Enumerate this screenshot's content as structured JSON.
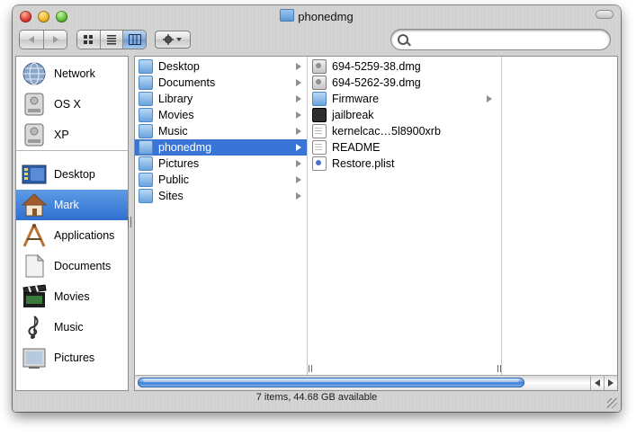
{
  "window": {
    "title": "phonedmg",
    "status": "7 items, 44.68 GB available"
  },
  "toolbar": {
    "back_icon": "back-arrow-icon",
    "forward_icon": "forward-arrow-icon",
    "view_modes": [
      "icon",
      "list",
      "column"
    ],
    "active_view": "column",
    "action_icon": "gear-icon",
    "search_placeholder": ""
  },
  "sidebar": {
    "devices": [
      {
        "label": "Network",
        "icon": "network-globe-icon"
      },
      {
        "label": "OS X",
        "icon": "hard-drive-icon"
      },
      {
        "label": "XP",
        "icon": "hard-drive-icon"
      }
    ],
    "places": [
      {
        "label": "Desktop",
        "icon": "desktop-icon",
        "selected": false
      },
      {
        "label": "Mark",
        "icon": "home-icon",
        "selected": true
      },
      {
        "label": "Applications",
        "icon": "applications-icon",
        "selected": false
      },
      {
        "label": "Documents",
        "icon": "documents-icon",
        "selected": false
      },
      {
        "label": "Movies",
        "icon": "movies-icon",
        "selected": false
      },
      {
        "label": "Music",
        "icon": "music-icon",
        "selected": false
      },
      {
        "label": "Pictures",
        "icon": "pictures-icon",
        "selected": false
      }
    ],
    "selection_color": "#3875d7"
  },
  "columns": [
    {
      "items": [
        {
          "label": "Desktop",
          "kind": "folder",
          "has_children": true,
          "selected": false
        },
        {
          "label": "Documents",
          "kind": "folder",
          "has_children": true,
          "selected": false
        },
        {
          "label": "Library",
          "kind": "folder",
          "has_children": true,
          "selected": false
        },
        {
          "label": "Movies",
          "kind": "folder",
          "has_children": true,
          "selected": false
        },
        {
          "label": "Music",
          "kind": "folder",
          "has_children": true,
          "selected": false
        },
        {
          "label": "phonedmg",
          "kind": "folder",
          "has_children": true,
          "selected": true
        },
        {
          "label": "Pictures",
          "kind": "folder",
          "has_children": true,
          "selected": false
        },
        {
          "label": "Public",
          "kind": "folder",
          "has_children": true,
          "selected": false
        },
        {
          "label": "Sites",
          "kind": "folder",
          "has_children": true,
          "selected": false
        }
      ]
    },
    {
      "items": [
        {
          "label": "694-5259-38.dmg",
          "kind": "dmg",
          "has_children": false
        },
        {
          "label": "694-5262-39.dmg",
          "kind": "dmg",
          "has_children": false
        },
        {
          "label": "Firmware",
          "kind": "folder",
          "has_children": true
        },
        {
          "label": "jailbreak",
          "kind": "exec",
          "has_children": false
        },
        {
          "label": "kernelcac…5l8900xrb",
          "kind": "doc",
          "has_children": false
        },
        {
          "label": "README",
          "kind": "doc",
          "has_children": false
        },
        {
          "label": "Restore.plist",
          "kind": "plist",
          "has_children": false
        }
      ]
    },
    {
      "items": []
    }
  ]
}
